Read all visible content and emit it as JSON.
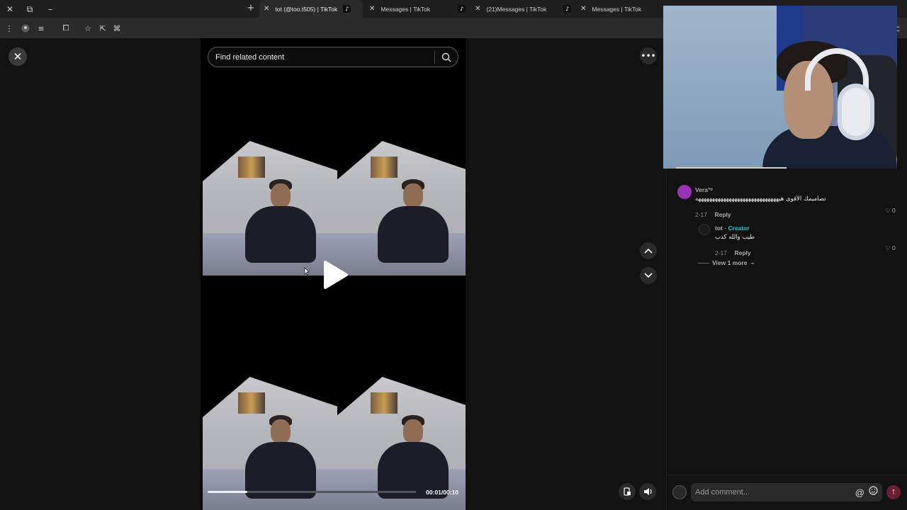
{
  "browser": {
    "tabs": [
      {
        "label": "tot (@too.t505) | TikTok",
        "active": true
      },
      {
        "label": "Messages | TikTok",
        "active": false
      },
      {
        "label": "(21)Messages | TikTok",
        "active": false
      },
      {
        "label": "Messages | TikTok",
        "active": false
      }
    ]
  },
  "search": {
    "placeholder": "Find related content"
  },
  "player": {
    "time": "00:01/00:10",
    "progress_fraction": 0.19
  },
  "comments": [
    {
      "user": "Vera°ᵒ",
      "text": "تصاميمك الأقوى هيهههههههههههههههههههههههههههههه",
      "date": "2-17",
      "reply_label": "Reply",
      "likes": "0",
      "avatar_color": "#9b30b9"
    },
    {
      "user": "tot",
      "badge": "Creator",
      "separator": "·",
      "text": "طيب والله كذب",
      "date": "2-17",
      "reply_label": "Reply",
      "likes": "0"
    }
  ],
  "view_more": "View 1 more",
  "comment_box": {
    "placeholder": "Add comment...",
    "mention_symbol": "@"
  },
  "colors": {
    "accent_creator": "#2bc3d3",
    "post_button": "#6b1f2e"
  }
}
